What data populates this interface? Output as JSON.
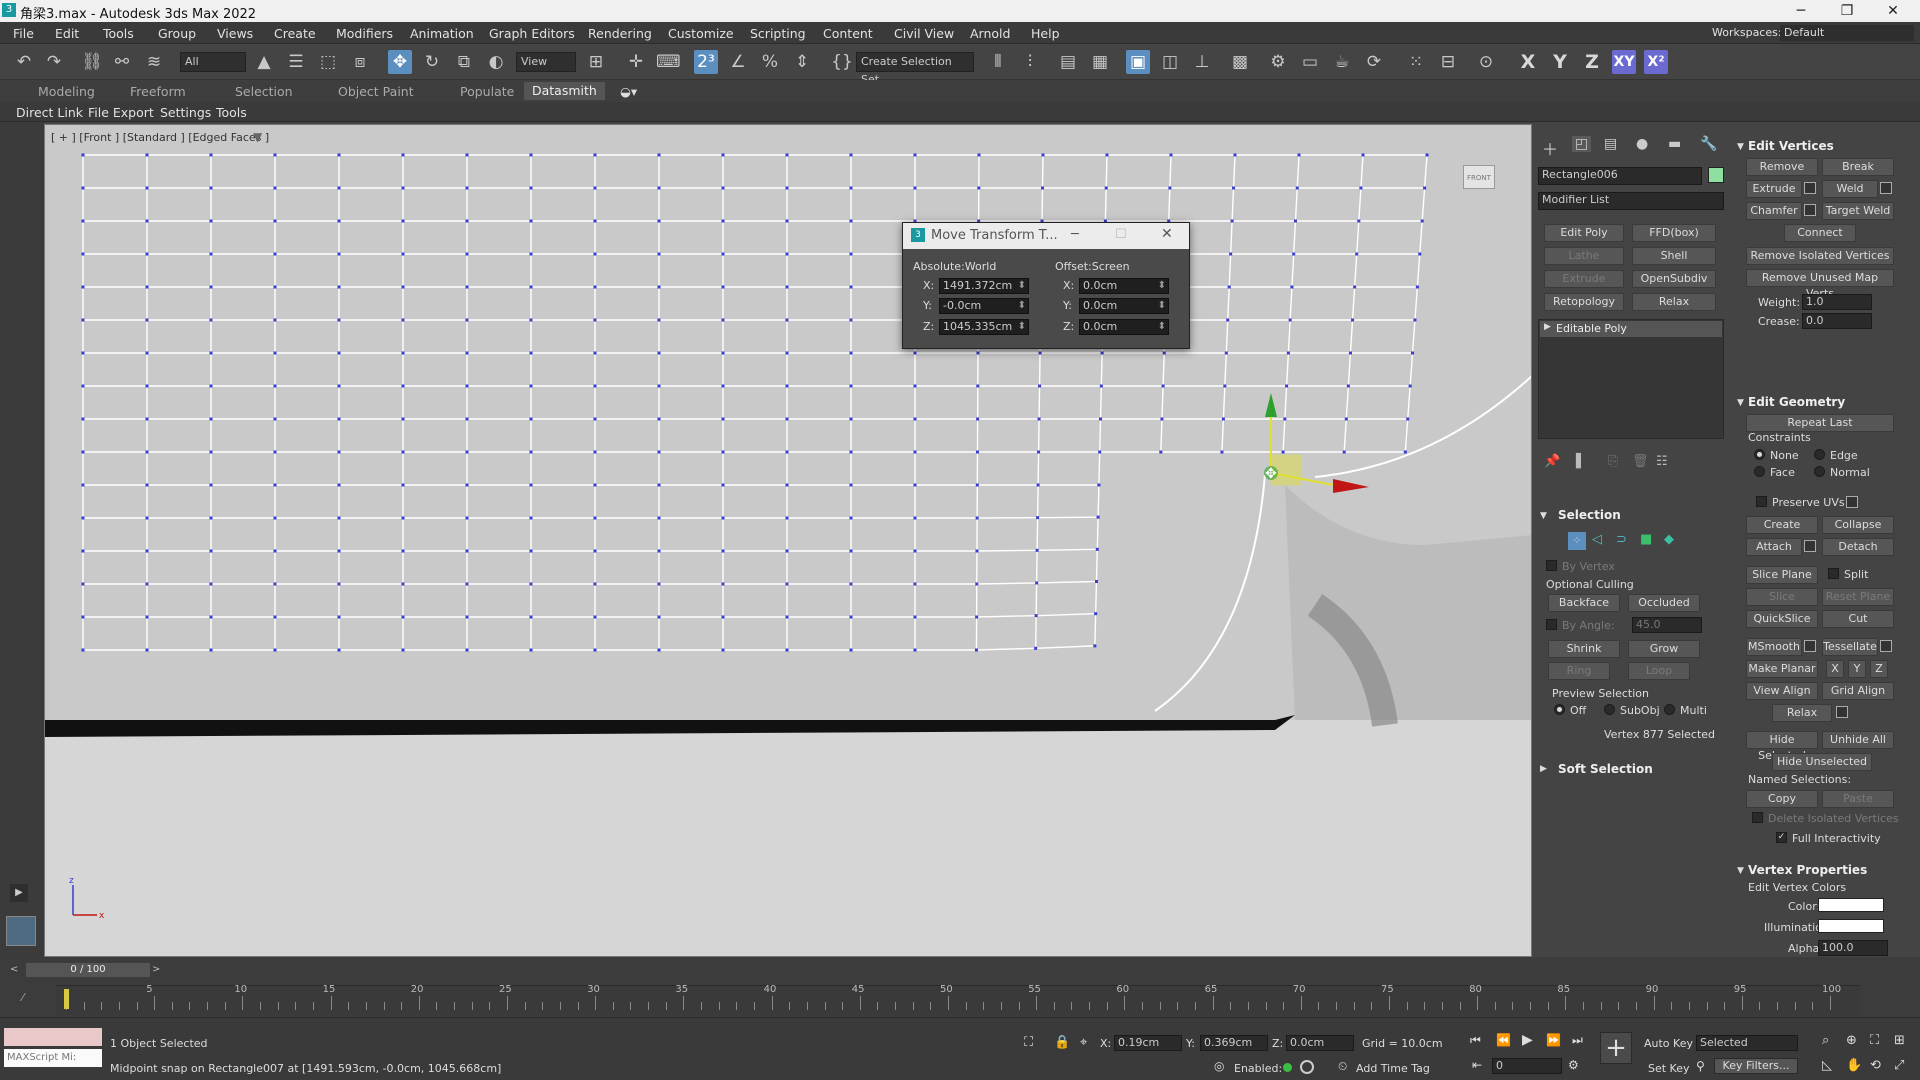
{
  "window": {
    "title": "角梁3.max - Autodesk 3ds Max 2022",
    "minimize": "─",
    "restore": "❐",
    "close": "✕"
  },
  "menu": [
    "File",
    "Edit",
    "Tools",
    "Group",
    "Views",
    "Create",
    "Modifiers",
    "Animation",
    "Graph Editors",
    "Rendering",
    "Customize",
    "Scripting",
    "Content",
    "Civil View",
    "Arnold",
    "Help"
  ],
  "workspace": {
    "label": "Workspaces:",
    "value": "Default"
  },
  "toolbar": {
    "selection_filter": "All",
    "ref_coord": "View",
    "named_selection": "Create Selection Set",
    "axes": [
      "X",
      "Y",
      "Z",
      "XY",
      "X²"
    ]
  },
  "ribbon_tabs": [
    "Modeling",
    "Freeform",
    "Selection",
    "Object Paint",
    "Populate",
    "Datasmith"
  ],
  "ribbon_active": "Datasmith",
  "sub_ribbon": [
    "Direct Link",
    "File Export",
    "Settings",
    "Tools"
  ],
  "viewport": {
    "label": "[ + ] [Front ] [Standard ] [Edged Faces ]",
    "viewcube": "FRONT"
  },
  "move_dialog": {
    "title": "Move Transform T...",
    "abs_label": "Absolute:World",
    "off_label": "Offset:Screen",
    "abs": {
      "x": "1491.372cm",
      "y": "-0.0cm",
      "z": "1045.335cm"
    },
    "off": {
      "x": "0.0cm",
      "y": "0.0cm",
      "z": "0.0cm"
    }
  },
  "command_panel": {
    "object_name": "Rectangle006",
    "object_color": "#8ee0a0",
    "modifier_list": "Modifier List",
    "mod_buttons": [
      [
        "Edit Poly",
        "FFD(box)"
      ],
      [
        "Lathe",
        "Shell"
      ],
      [
        "Extrude",
        "OpenSubdiv"
      ],
      [
        "Retopology",
        "Relax"
      ]
    ],
    "stack_item": "Editable Poly",
    "selection": {
      "title": "Selection",
      "by_vertex": "By Vertex",
      "optional_culling": "Optional Culling",
      "backface": "Backface",
      "occluded": "Occluded",
      "by_angle": "By Angle:",
      "by_angle_val": "45.0",
      "shrink": "Shrink",
      "grow": "Grow",
      "ring": "Ring",
      "loop": "Loop",
      "preview": "Preview Selection",
      "off": "Off",
      "subobj": "SubObj",
      "multi": "Multi",
      "status": "Vertex 877 Selected"
    },
    "soft_selection": "Soft Selection",
    "edit_vertices": {
      "title": "Edit Vertices",
      "remove": "Remove",
      "break": "Break",
      "extrude": "Extrude",
      "weld": "Weld",
      "chamfer": "Chamfer",
      "target_weld": "Target Weld",
      "connect": "Connect",
      "remove_isolated": "Remove Isolated Vertices",
      "remove_unused": "Remove Unused Map Verts",
      "weight_label": "Weight:",
      "weight": "1.0",
      "crease_label": "Crease:",
      "crease": "0.0"
    },
    "edit_geometry": {
      "title": "Edit Geometry",
      "repeat_last": "Repeat Last",
      "constraints": "Constraints",
      "none": "None",
      "edge": "Edge",
      "face": "Face",
      "normal": "Normal",
      "preserve_uvs": "Preserve UVs",
      "create": "Create",
      "collapse": "Collapse",
      "attach": "Attach",
      "detach": "Detach",
      "slice_plane": "Slice Plane",
      "split": "Split",
      "slice": "Slice",
      "reset_plane": "Reset Plane",
      "quickslice": "QuickSlice",
      "cut": "Cut",
      "msmooth": "MSmooth",
      "tessellate": "Tessellate",
      "make_planar": "Make Planar",
      "x": "X",
      "y": "Y",
      "z": "Z",
      "view_align": "View Align",
      "grid_align": "Grid Align",
      "relax": "Relax",
      "hide_selected": "Hide Selected",
      "unhide_all": "Unhide All",
      "hide_unselected": "Hide Unselected",
      "named_selections": "Named Selections:",
      "copy": "Copy",
      "paste": "Paste",
      "delete_isolated": "Delete Isolated Vertices",
      "full_interactivity": "Full Interactivity"
    },
    "vertex_properties": {
      "title": "Vertex Properties",
      "edit_colors": "Edit Vertex Colors",
      "color": "Color:",
      "illumination": "Illumination:",
      "alpha": "Alpha:",
      "alpha_val": "100.0"
    }
  },
  "timeline": {
    "frame": "0 / 100",
    "ticks": [
      "5",
      "10",
      "15",
      "20",
      "25",
      "30",
      "35",
      "40",
      "45",
      "50",
      "55",
      "60",
      "65",
      "70",
      "75",
      "80",
      "85",
      "90",
      "95",
      "100"
    ]
  },
  "status": {
    "maxscript": "MAXScript Mi:",
    "objects": "1 Object Selected",
    "prompt": "Midpoint snap on Rectangle007 at [1491.593cm, -0.0cm, 1045.668cm]",
    "x_label": "X:",
    "x": "0.19cm",
    "y_label": "Y:",
    "y": "0.369cm",
    "z_label": "Z:",
    "z": "0.0cm",
    "grid": "Grid = 10.0cm",
    "enabled": "Enabled:",
    "add_time_tag": "Add Time Tag",
    "auto_key": "Auto Key",
    "set_key": "Set Key",
    "key_mode": "Selected",
    "key_filters": "Key Filters...",
    "frame": "0"
  }
}
